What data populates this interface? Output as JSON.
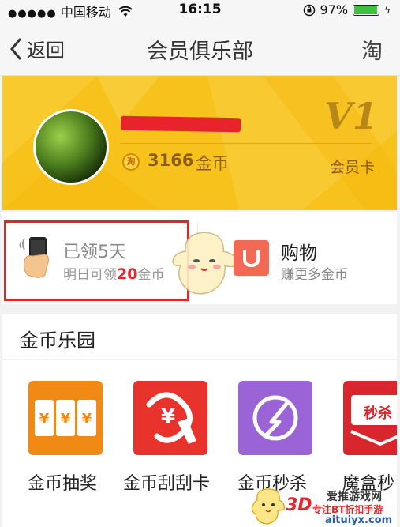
{
  "status_bar": {
    "signal": "●●●●●",
    "carrier": "中国移动",
    "time": "16:15",
    "battery_percent": "97%",
    "battery_level": 0.97,
    "battery_color": "#3bc13b"
  },
  "nav": {
    "back_label": "返回",
    "title": "会员俱乐部",
    "right_label": "淘"
  },
  "profile": {
    "coin_badge": "淘",
    "coins": "3166",
    "coins_unit": "金币",
    "vip_level": "V1",
    "vip_card_label": "会员卡",
    "banner_color": "#f7c21b"
  },
  "signin": {
    "title": "已领5天",
    "sub_prefix": "明日可领",
    "sub_amount": "20",
    "sub_suffix": "金币",
    "highlight_color": "#e2242b"
  },
  "shopping": {
    "title": "购物",
    "subtitle": "赚更多金币"
  },
  "coin_park": {
    "title": "金币乐园",
    "items": [
      {
        "label": "金币抽奖",
        "icon": "lottery-icon",
        "color": "#f08a14",
        "icon_text": "¥¥¥"
      },
      {
        "label": "金币刮刮卡",
        "icon": "scratch-card-icon",
        "color": "#e8322c",
        "icon_text": "¥"
      },
      {
        "label": "金币秒杀",
        "icon": "flash-sale-icon",
        "color": "#9a63d6",
        "icon_text": ""
      },
      {
        "label": "魔盒秒",
        "icon": "magic-box-icon",
        "color": "#d9262c",
        "icon_text": "秒杀"
      }
    ]
  },
  "watermark": {
    "brand": "3D",
    "line1": "爱推游戏网",
    "line2": "专注BT折扣手游",
    "line3": "aituiyx.com"
  }
}
